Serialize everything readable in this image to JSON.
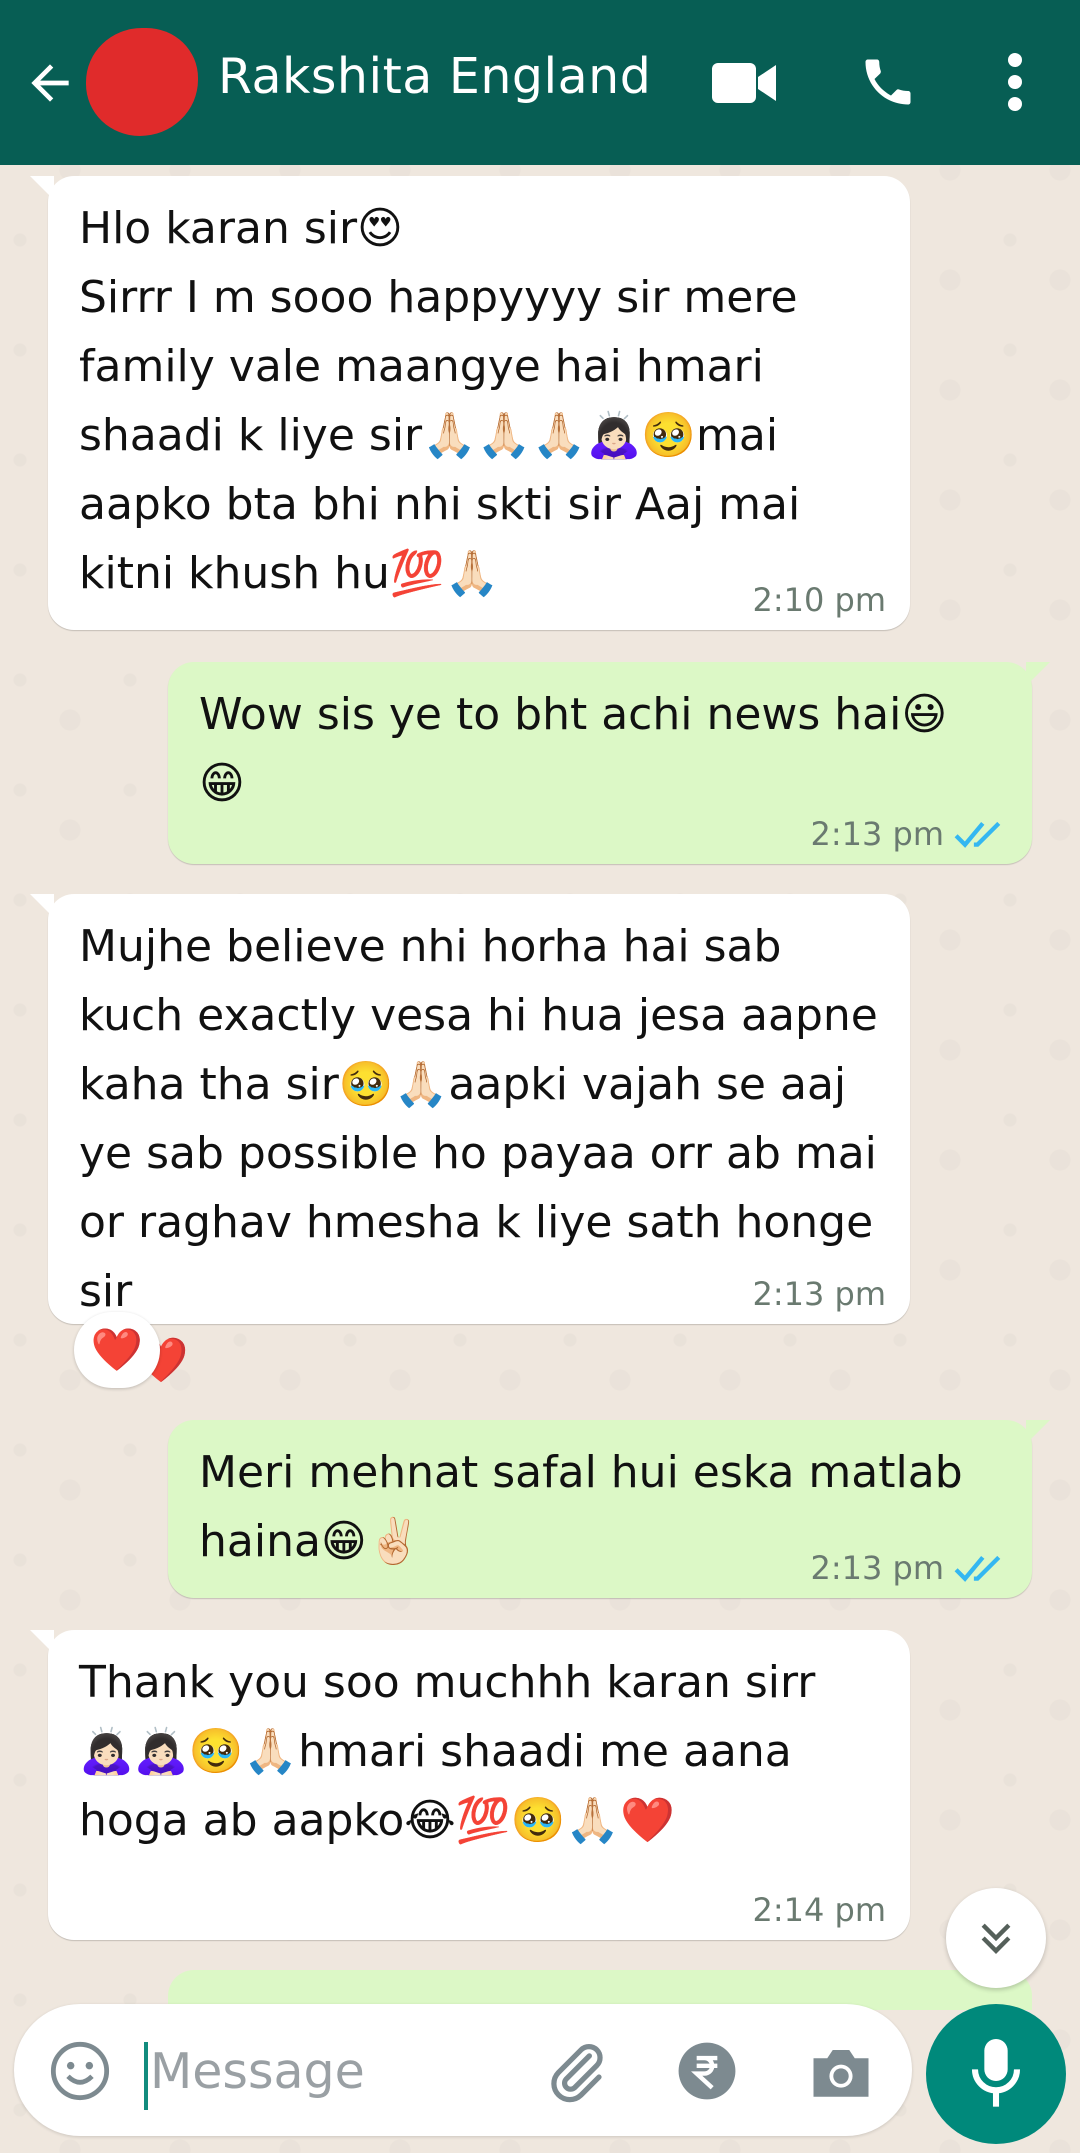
{
  "header": {
    "contact_name": "Rakshita England",
    "icons": [
      "back-arrow-icon",
      "video-call-icon",
      "phone-icon",
      "more-vert-icon"
    ],
    "color": "#075e54"
  },
  "messages": [
    {
      "direction": "incoming",
      "text": "Hlo karan sir😍\nSirrr I m sooo happyyyy sir mere family vale maangye hai hmari shaadi k liye sir🙏🏻🙏🏻🙏🏻🙇🏻‍♀️🥹mai aapko bta bhi nhi skti sir Aaj mai kitni khush hu💯🙏🏻",
      "time": "2:10 pm"
    },
    {
      "direction": "outgoing",
      "text": "Wow sis ye to bht achi news hai😃\n😁",
      "time": "2:13 pm",
      "status": "read"
    },
    {
      "direction": "incoming",
      "text": "Mujhe believe nhi horha hai sab kuch exactly vesa hi hua jesa aapne kaha tha sir🥹🙏🏻aapki vajah se aaj ye sab possible ho payaa orr ab mai or raghav hmesha k liye sath honge sir\n🥹❤️",
      "time": "2:13 pm",
      "reaction": "❤️"
    },
    {
      "direction": "outgoing",
      "text": "Meri mehnat safal hui eska matlab haina😁✌🏻",
      "time": "2:13 pm",
      "status": "read"
    },
    {
      "direction": "incoming",
      "text": "Thank you soo muchhh karan sirr\n🙇🏻‍♀️🙇🏻‍♀️🥹🙏🏻hmari shaadi me aana hoga ab aapko😂💯🥹🙏🏻❤️",
      "time": "2:14 pm"
    }
  ],
  "composer": {
    "placeholder": "Message",
    "icons": [
      "emoji-icon",
      "attach-icon",
      "rupee-payment-icon",
      "camera-icon",
      "mic-icon"
    ],
    "accent": "#00897b"
  },
  "colors": {
    "incoming_bubble": "#ffffff",
    "outgoing_bubble": "#dcf8c6",
    "read_ticks": "#34b7f1"
  }
}
